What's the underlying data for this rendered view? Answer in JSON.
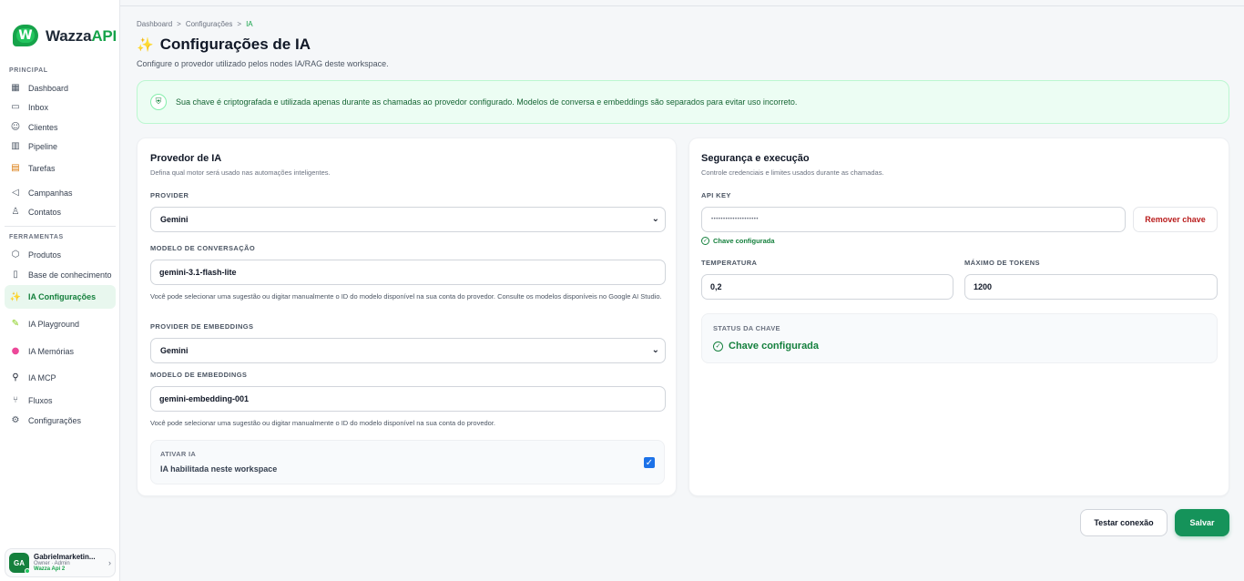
{
  "app": {
    "logo_main": "Wazza",
    "logo_accent": "API",
    "logo_mark": "W"
  },
  "sidebar": {
    "section_principal": "PRINCIPAL",
    "section_ferramentas": "FERRAMENTAS",
    "items": [
      {
        "label": "Dashboard",
        "icon": "grid-icon",
        "glyph": "▦"
      },
      {
        "label": "Inbox",
        "icon": "message-icon",
        "glyph": "▭"
      },
      {
        "label": "Clientes",
        "icon": "users-icon",
        "glyph": "☺"
      },
      {
        "label": "Pipeline",
        "icon": "bar-chart-icon",
        "glyph": "▥"
      },
      {
        "label": "Tarefas",
        "icon": "clipboard-icon",
        "glyph": "▤"
      },
      {
        "label": "Campanhas",
        "icon": "send-icon",
        "glyph": "◁"
      },
      {
        "label": "Contatos",
        "icon": "user-plus-icon",
        "glyph": "♙"
      },
      {
        "label": "Produtos",
        "icon": "box-icon",
        "glyph": "⬡"
      },
      {
        "label": "Base de conhecimento",
        "icon": "book-icon",
        "glyph": "▯"
      },
      {
        "label": "IA Configurações",
        "icon": "sparkles-icon",
        "glyph": "✨"
      },
      {
        "label": "IA Playground",
        "icon": "pencil-icon",
        "glyph": "✎"
      },
      {
        "label": "IA Memórias",
        "icon": "brain-icon",
        "glyph": "●"
      },
      {
        "label": "IA MCP",
        "icon": "plug-icon",
        "glyph": "⚲"
      },
      {
        "label": "Fluxos",
        "icon": "flow-icon",
        "glyph": "⑂"
      },
      {
        "label": "Configurações",
        "icon": "gear-icon",
        "glyph": "⚙"
      }
    ]
  },
  "user": {
    "initials": "GA",
    "name": "Gabrielmarketin...",
    "role": "Owner · Admin",
    "workspace": "Wazza Api 2"
  },
  "breadcrumb": [
    "Dashboard",
    ">",
    "Configurações",
    ">",
    "IA"
  ],
  "page": {
    "title": "Configurações de IA",
    "subtitle": "Configure o provedor utilizado pelos nodes IA/RAG deste workspace."
  },
  "alert": {
    "text": "Sua chave é criptografada e utilizada apenas durante as chamadas ao provedor configurado. Modelos de conversa e embeddings são separados para evitar uso incorreto."
  },
  "provider_card": {
    "title": "Provedor de IA",
    "description": "Defina qual motor será usado nas automações inteligentes.",
    "provider_label": "PROVIDER",
    "provider_value": "Gemini",
    "chat_model_label": "MODELO DE CONVERSAÇÃO",
    "chat_model_value": "gemini-3.1-flash-lite",
    "chat_model_help": "Você pode selecionar uma sugestão ou digitar manualmente o ID do modelo disponível na sua conta do provedor. Consulte os modelos disponíveis no Google AI Studio.",
    "embed_provider_label": "PROVIDER DE EMBEDDINGS",
    "embed_provider_value": "Gemini",
    "embed_model_label": "MODELO DE EMBEDDINGS",
    "embed_model_value": "gemini-embedding-001",
    "embed_model_help": "Você pode selecionar uma sugestão ou digitar manualmente o ID do modelo disponível na sua conta do provedor.",
    "activate_label": "ATIVAR IA",
    "activate_text": "IA habilitada neste workspace",
    "activate_checked": true
  },
  "security_card": {
    "title": "Segurança e execução",
    "description": "Controle credenciais e limites usados durante as chamadas.",
    "api_key_label": "API KEY",
    "api_key_value": "••••••••••••••••••••",
    "remove_key_button": "Remover chave",
    "key_configured": "Chave configurada",
    "temperature_label": "TEMPERATURA",
    "temperature_value": "0,2",
    "max_tokens_label": "MÁXIMO DE TOKENS",
    "max_tokens_value": "1200",
    "status_label": "STATUS DA CHAVE",
    "status_value": "Chave configurada"
  },
  "actions": {
    "test_button": "Testar conexão",
    "save_button": "Salvar"
  },
  "colors": {
    "accent": "#15935a",
    "danger": "#b91c1c",
    "alert_bg": "#ecfdf3"
  }
}
